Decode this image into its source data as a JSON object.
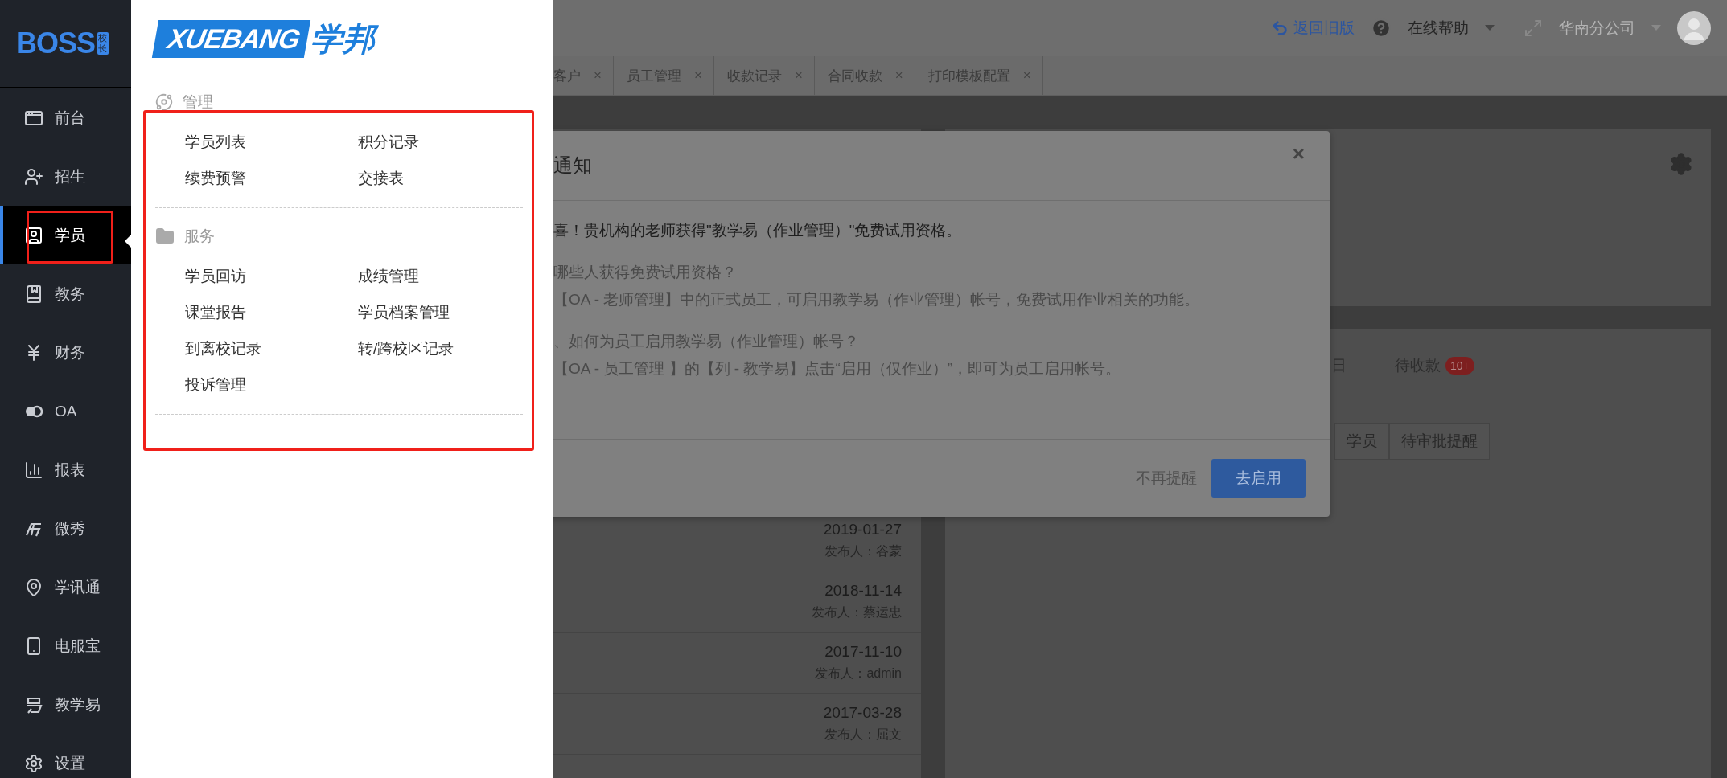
{
  "sidebar": {
    "logo": {
      "text": "BOSS",
      "badge": "校长"
    },
    "items": [
      {
        "label": "前台",
        "selected": false
      },
      {
        "label": "招生",
        "selected": false
      },
      {
        "label": "学员",
        "selected": true
      },
      {
        "label": "教务",
        "selected": false
      },
      {
        "label": "财务",
        "selected": false
      },
      {
        "label": "OA",
        "selected": false
      },
      {
        "label": "报表",
        "selected": false
      },
      {
        "label": "微秀",
        "selected": false
      },
      {
        "label": "学讯通",
        "selected": false
      },
      {
        "label": "电服宝",
        "selected": false
      },
      {
        "label": "教学易",
        "selected": false
      },
      {
        "label": "设置",
        "selected": false
      }
    ]
  },
  "flyout": {
    "logo": {
      "latin": "XUEBANG",
      "cjk": "学邦"
    },
    "sections": [
      {
        "title": "管理",
        "items": [
          "学员列表",
          "积分记录",
          "续费预警",
          "交接表"
        ]
      },
      {
        "title": "服务",
        "items": [
          "学员回访",
          "成绩管理",
          "课堂报告",
          "学员档案管理",
          "到离校记录",
          "转/跨校区记录",
          "投诉管理"
        ]
      }
    ]
  },
  "top_bar": {
    "back_link": "返回旧版",
    "help": "在线帮助",
    "branch": "华南分公司"
  },
  "tabs": [
    {
      "label": "客户",
      "selected": false
    },
    {
      "label": "员工管理",
      "selected": false
    },
    {
      "label": "收款记录",
      "selected": false
    },
    {
      "label": "合同收款",
      "selected": false
    },
    {
      "label": "打印模板配置",
      "selected": false
    }
  ],
  "tab_close": "×",
  "notices": [
    {
      "date": "2019-01-27",
      "publisher": "发布人：谷蒙"
    },
    {
      "date": "2018-11-14",
      "publisher": "发布人：蔡运忠"
    },
    {
      "date": "2017-11-10",
      "publisher": "发布人：admin"
    },
    {
      "date": "2017-03-28",
      "publisher": "发布人：屈文"
    }
  ],
  "dashboard": {
    "tabs": [
      {
        "label": "日",
        "selected": false
      },
      {
        "label": "待收款",
        "selected": false,
        "badge": "10+"
      }
    ],
    "buttons": [
      "学员",
      "待审批提醒"
    ]
  },
  "modal": {
    "title": "通知",
    "close": "×",
    "headline": "喜！贵机构的老师获得\"教学易（作业管理）\"免费试用资格。",
    "paragraphs": [
      {
        "question": "哪些人获得免费试用资格？",
        "answer": "【OA - 老师管理】中的正式员工，可启用教学易（作业管理）帐号，免费试用作业相关的功能。"
      },
      {
        "question": "、如何为员工启用教学易（作业管理）帐号？",
        "answer": "【OA - 员工管理 】的【列 - 教学易】点击“启用（仅作业）”，即可为员工启用帐号。"
      }
    ],
    "buttons": [
      {
        "label": "不再提醒",
        "kind": "link"
      },
      {
        "label": "去启用",
        "kind": "primary"
      }
    ]
  }
}
